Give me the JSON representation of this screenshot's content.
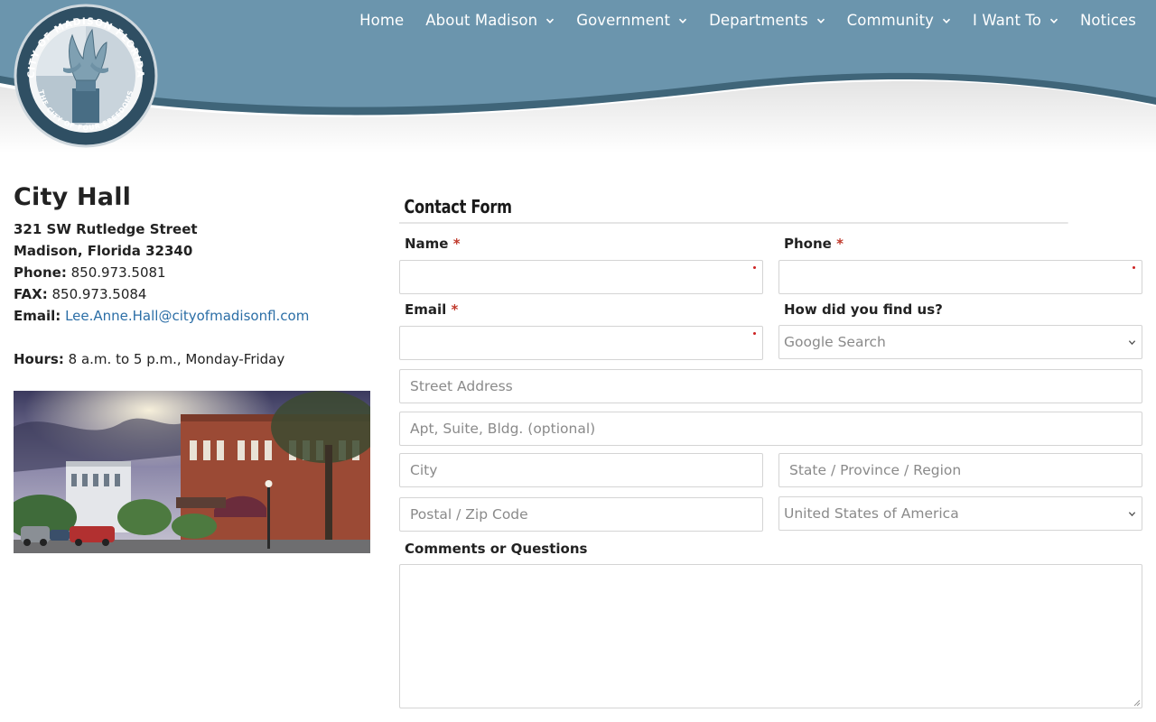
{
  "logo": {
    "ring_top_text": "CITY OF MADISON FLORIDA",
    "ring_bottom_text": "THE CITY OF FOUR FREEDOMS"
  },
  "nav": {
    "items": [
      {
        "label": "Home",
        "has_dropdown": false
      },
      {
        "label": "About Madison",
        "has_dropdown": true
      },
      {
        "label": "Government",
        "has_dropdown": true
      },
      {
        "label": "Departments",
        "has_dropdown": true
      },
      {
        "label": "Community",
        "has_dropdown": true
      },
      {
        "label": "I Want To",
        "has_dropdown": true
      },
      {
        "label": "Notices",
        "has_dropdown": false
      }
    ]
  },
  "contact": {
    "title": "City Hall",
    "street": "321 SW Rutledge Street",
    "city_line": "Madison, Florida 32340",
    "phone_label": "Phone:",
    "phone": "850.973.5081",
    "fax_label": "FAX:",
    "fax": "850.973.5084",
    "email_label": "Email:",
    "email": "Lee.Anne.Hall@cityofmadisonfl.com",
    "hours_label": "Hours:",
    "hours": "8 a.m. to 5 p.m., Monday-Friday"
  },
  "form": {
    "title": "Contact Form",
    "required_mark": "*",
    "name_label": "Name",
    "phone_label": "Phone",
    "email_label": "Email",
    "find_label": "How did you find us?",
    "find_selected": "Google Search",
    "street_placeholder": "Street Address",
    "apt_placeholder": "Apt, Suite, Bldg. (optional)",
    "city_placeholder": "City",
    "state_placeholder": "State / Province / Region",
    "zip_placeholder": "Postal / Zip Code",
    "country_selected": "United States of America",
    "comments_label": "Comments or Questions"
  },
  "colors": {
    "header_blue": "#6b95ad",
    "header_dark": "#3f6579",
    "link": "#2b6ea6",
    "required": "#c0392b"
  }
}
